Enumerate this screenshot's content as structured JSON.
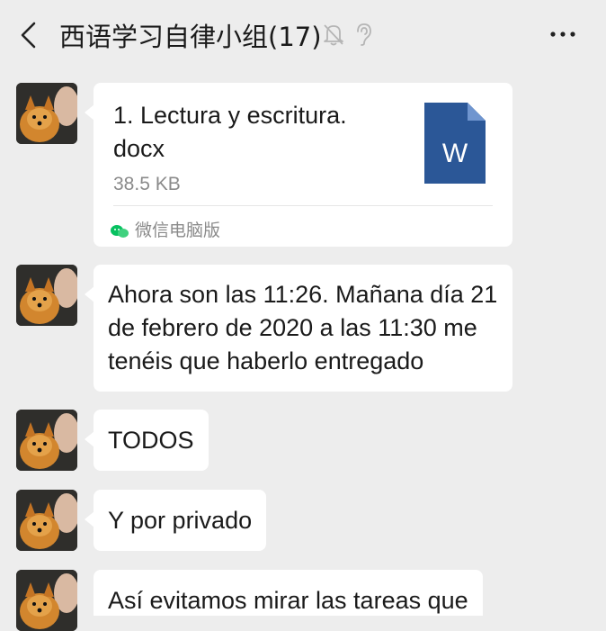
{
  "header": {
    "back_icon": "chevron-left-icon",
    "title": "西语学习自律小组(17)",
    "mute_icon": "bell-off-icon",
    "ear_icon": "ear-icon",
    "more_icon": "more-dots-icon"
  },
  "messages": [
    {
      "type": "file",
      "file_name": "1. Lectura y escritura.\ndocx",
      "file_size": "38.5 KB",
      "file_icon_letter": "W",
      "source": "微信电脑版"
    },
    {
      "type": "text",
      "text": "Ahora son las 11:26. Mañana día 21 de febrero de 2020 a las 11:30 me tenéis que haberlo entregado"
    },
    {
      "type": "text",
      "text": "TODOS"
    },
    {
      "type": "text",
      "text": "Y por privado"
    },
    {
      "type": "text",
      "text": "Así evitamos mirar las tareas que"
    }
  ],
  "colors": {
    "background": "#ededed",
    "bubble": "#ffffff",
    "word_blue": "#2b5797",
    "wechat_green": "#07c160"
  }
}
